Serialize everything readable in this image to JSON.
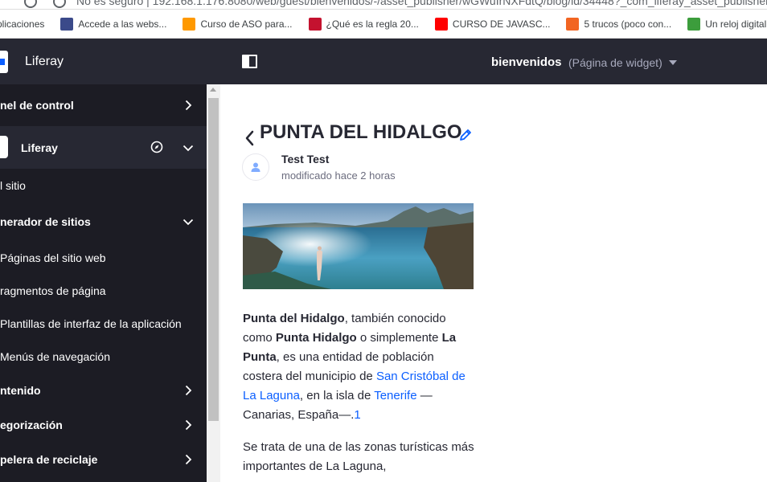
{
  "browser": {
    "url": "No es seguro | 192.168.1.176:8080/web/guest/bienvenidos/-/asset_publisher/wGWuIrNXFdtQ/blog/id/34448?_com_liferay_asset_publisher_",
    "bookmarks": [
      {
        "label": "plicaciones",
        "icon": "apps-icon",
        "color": "#4285f4"
      },
      {
        "label": "Accede a las webs...",
        "icon": "az-icon",
        "color": "#3b4a8a"
      },
      {
        "label": "Curso de ASO para...",
        "icon": "amazon-icon",
        "color": "#ff9900"
      },
      {
        "label": "¿Qué es la regla 20...",
        "icon": "muy-icon",
        "color": "#c4122f"
      },
      {
        "label": "CURSO DE JAVASC...",
        "icon": "youtube-icon",
        "color": "#ff0000"
      },
      {
        "label": "5 trucos (poco con...",
        "icon": "l-icon",
        "color": "#f26522"
      },
      {
        "label": "Un reloj digital c",
        "icon": "code-icon",
        "color": "#3c9d3c"
      }
    ]
  },
  "sidebar": {
    "title": "Liferay",
    "items": [
      {
        "label": "nel de control",
        "bold": true,
        "chevron": "right"
      },
      {
        "label": "Liferay",
        "bold": true,
        "chevron": "down",
        "site": true
      },
      {
        "label": "l sitio",
        "bold": false
      },
      {
        "label": "nerador de sitios",
        "bold": true,
        "chevron": "down"
      },
      {
        "label": "Páginas del sitio web",
        "bold": false
      },
      {
        "label": "ragmentos de página",
        "bold": false
      },
      {
        "label": "Plantillas de interfaz de la aplicación",
        "bold": false
      },
      {
        "label": "Menús de navegación",
        "bold": false
      },
      {
        "label": "ntenido",
        "bold": true,
        "chevron": "right"
      },
      {
        "label": "egorización",
        "bold": true,
        "chevron": "right"
      },
      {
        "label": "pelera de reciclaje",
        "bold": true,
        "chevron": "right"
      }
    ]
  },
  "topbar": {
    "page_title": "bienvenidos",
    "page_type": "(Página de widget)"
  },
  "article": {
    "title": "PUNTA DEL HIDALGO",
    "author": "Test Test",
    "modified": "modificado hace 2 horas",
    "p1": {
      "s1": "Punta del Hidalgo",
      "s2": ", también conocido como ",
      "s3": "Punta Hidalgo",
      "s4": " o simplemente ",
      "s5": "La Punta",
      "s6": ", es una entidad de población costera del municipio de ",
      "link1": "San Cristóbal de La Laguna",
      "s7": ", en la isla de ",
      "link2": "Tenerife",
      "s8": " — Canarias, España—.",
      "ref": "1"
    },
    "p2": "Se trata de una de las zonas turísticas más importantes de La Laguna,"
  },
  "colors": {
    "sidebar_bg": "#1c1c24",
    "header_bg": "#272833",
    "link": "#0b5fff"
  }
}
